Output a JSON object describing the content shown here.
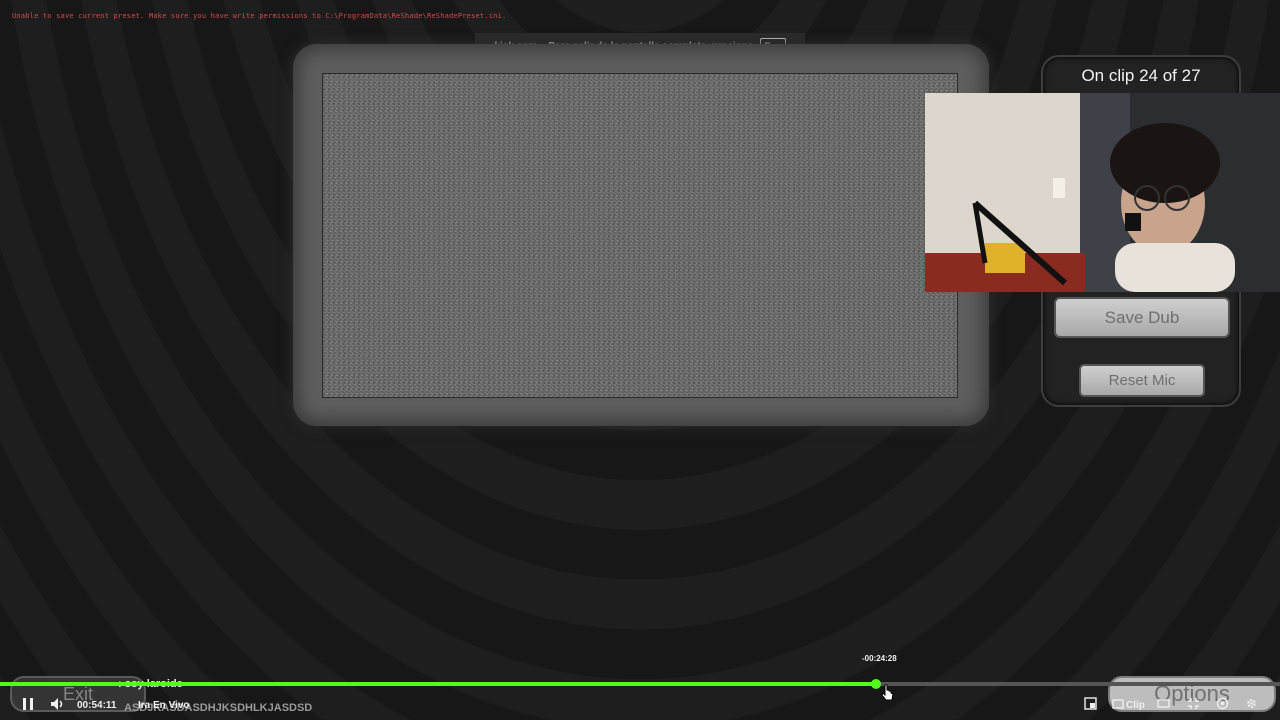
{
  "overlay": {
    "warning": "Unable to save current preset. Make sure you have write permissions to C:\\ProgramData\\ReShade\\ReShadePreset.ini.",
    "fullscreen_toast": "kick.com – Para salir de la pantalla completa, presiona",
    "fullscreen_key": "Esc"
  },
  "game": {
    "clip_counter": "On clip 24 of 27",
    "save_dub": "Save Dub",
    "reset_mic": "Reset Mic",
    "exit": "Exit",
    "options": "Options"
  },
  "player": {
    "elapsed": "00:54:11",
    "live_label": "Ira En Vivo",
    "hover_time": "-00:24:28",
    "progress": 0.684,
    "clip_label": "Clip",
    "colors": {
      "accent": "#53fc18",
      "track": "#555555"
    }
  },
  "chat": {
    "username": ": soy laroide",
    "message": "ASDJKASDASDHJKSDHLKJASDSD"
  }
}
